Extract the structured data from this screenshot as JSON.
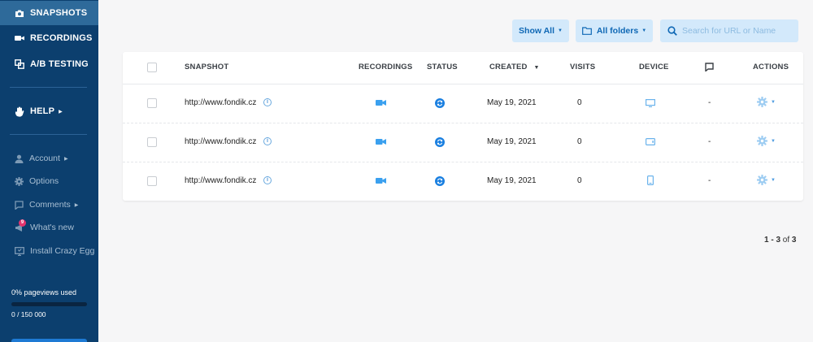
{
  "sidebar": {
    "nav": [
      {
        "label": "SNAPSHOTS",
        "icon": "camera-icon"
      },
      {
        "label": "RECORDINGS",
        "icon": "video-camera-icon"
      },
      {
        "label": "A/B TESTING",
        "icon": "ab-test-icon"
      }
    ],
    "help": {
      "label": "HELP",
      "icon": "hand-wave-icon"
    },
    "secondary": [
      {
        "label": "Account",
        "icon": "user-icon",
        "has_caret": true
      },
      {
        "label": "Options",
        "icon": "gear-icon",
        "has_caret": false
      },
      {
        "label": "Comments",
        "icon": "comment-icon",
        "has_caret": true
      },
      {
        "label": "What's new",
        "icon": "megaphone-icon",
        "has_caret": false,
        "badge": "9"
      },
      {
        "label": "Install Crazy Egg",
        "icon": "install-icon",
        "has_caret": false
      }
    ],
    "usage": {
      "label": "0% pageviews used",
      "count": "0 / 150 000",
      "percent_used": 0
    }
  },
  "toolbar": {
    "show_all_label": "Show All",
    "folders_label": "All folders",
    "search_placeholder": "Search for URL or Name"
  },
  "table": {
    "headers": {
      "snapshot": "SNAPSHOT",
      "recordings": "RECORDINGS",
      "status": "STATUS",
      "created": "CREATED",
      "visits": "VISITS",
      "device": "DEVICE",
      "actions": "ACTIONS"
    },
    "rows": [
      {
        "url": "http://www.fondik.cz",
        "created": "May 19, 2021",
        "visits": "0",
        "device": "desktop",
        "comments": "-"
      },
      {
        "url": "http://www.fondik.cz",
        "created": "May 19, 2021",
        "visits": "0",
        "device": "tablet",
        "comments": "-"
      },
      {
        "url": "http://www.fondik.cz",
        "created": "May 19, 2021",
        "visits": "0",
        "device": "mobile",
        "comments": "-"
      }
    ]
  },
  "pagination": {
    "range": "1 - 3",
    "of": "of",
    "total": "3"
  },
  "colors": {
    "sidebar_bg": "#0c3f6e",
    "sidebar_active": "#2e6a9a",
    "accent": "#1a8fe3",
    "button_bg": "#d3e9fb",
    "button_text": "#0f68b5"
  }
}
